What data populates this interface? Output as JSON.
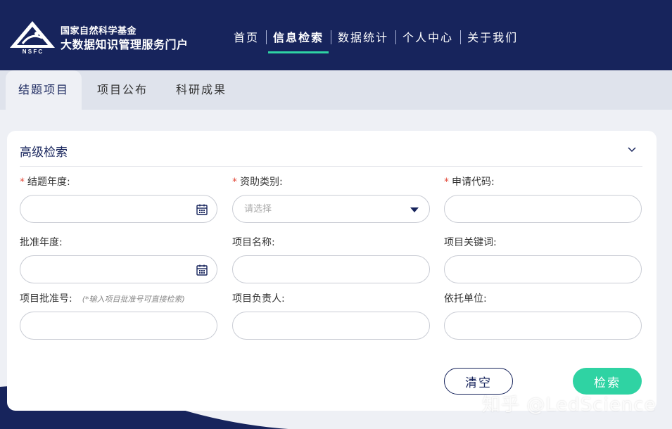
{
  "header": {
    "logo_abbr": "N S F C",
    "title_line1": "国家自然科学基金",
    "title_line2": "大数据知识管理服务门户",
    "nav": [
      {
        "label": "首页",
        "active": false
      },
      {
        "label": "信息检索",
        "active": true
      },
      {
        "label": "数据统计",
        "active": false
      },
      {
        "label": "个人中心",
        "active": false
      },
      {
        "label": "关于我们",
        "active": false
      }
    ]
  },
  "tabs": [
    {
      "label": "结题项目",
      "active": true
    },
    {
      "label": "项目公布",
      "active": false
    },
    {
      "label": "科研成果",
      "active": false
    }
  ],
  "search": {
    "title": "高级检索",
    "fields": {
      "end_year": {
        "label": "结题年度:",
        "required": true,
        "value": "",
        "icon": "calendar-icon"
      },
      "funding_type": {
        "label": "资助类别:",
        "required": true,
        "placeholder": "请选择",
        "icon": "dropdown-triangle-icon"
      },
      "apply_code": {
        "label": "申请代码:",
        "required": true,
        "value": ""
      },
      "approve_year": {
        "label": "批准年度:",
        "value": "",
        "icon": "calendar-icon"
      },
      "project_name": {
        "label": "项目名称:",
        "value": ""
      },
      "project_keywords": {
        "label": "项目关键词:",
        "value": ""
      },
      "approve_no": {
        "label": "项目批准号:",
        "hint": "(*输入项目批准号可直接检索)",
        "value": ""
      },
      "principal": {
        "label": "项目负责人:",
        "value": ""
      },
      "institution": {
        "label": "依托单位:",
        "value": ""
      }
    },
    "clear_label": "清空",
    "search_label": "检索"
  },
  "watermark": "知乎 @LedScience",
  "colors": {
    "navy": "#17245c",
    "accent": "#2fd3a3",
    "required": "#e24b3b"
  }
}
